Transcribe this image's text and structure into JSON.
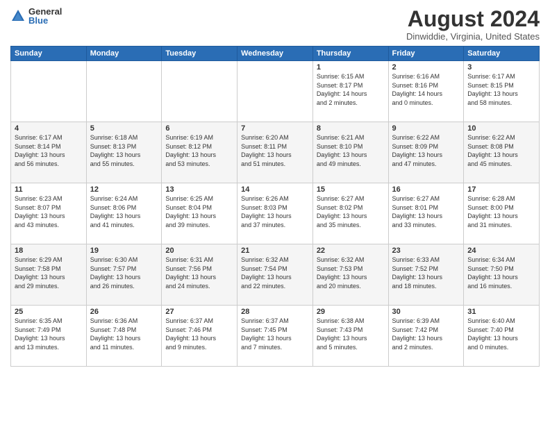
{
  "logo": {
    "general": "General",
    "blue": "Blue"
  },
  "title": "August 2024",
  "subtitle": "Dinwiddie, Virginia, United States",
  "days_header": [
    "Sunday",
    "Monday",
    "Tuesday",
    "Wednesday",
    "Thursday",
    "Friday",
    "Saturday"
  ],
  "weeks": [
    [
      {
        "day": "",
        "info": ""
      },
      {
        "day": "",
        "info": ""
      },
      {
        "day": "",
        "info": ""
      },
      {
        "day": "",
        "info": ""
      },
      {
        "day": "1",
        "info": "Sunrise: 6:15 AM\nSunset: 8:17 PM\nDaylight: 14 hours\nand 2 minutes."
      },
      {
        "day": "2",
        "info": "Sunrise: 6:16 AM\nSunset: 8:16 PM\nDaylight: 14 hours\nand 0 minutes."
      },
      {
        "day": "3",
        "info": "Sunrise: 6:17 AM\nSunset: 8:15 PM\nDaylight: 13 hours\nand 58 minutes."
      }
    ],
    [
      {
        "day": "4",
        "info": "Sunrise: 6:17 AM\nSunset: 8:14 PM\nDaylight: 13 hours\nand 56 minutes."
      },
      {
        "day": "5",
        "info": "Sunrise: 6:18 AM\nSunset: 8:13 PM\nDaylight: 13 hours\nand 55 minutes."
      },
      {
        "day": "6",
        "info": "Sunrise: 6:19 AM\nSunset: 8:12 PM\nDaylight: 13 hours\nand 53 minutes."
      },
      {
        "day": "7",
        "info": "Sunrise: 6:20 AM\nSunset: 8:11 PM\nDaylight: 13 hours\nand 51 minutes."
      },
      {
        "day": "8",
        "info": "Sunrise: 6:21 AM\nSunset: 8:10 PM\nDaylight: 13 hours\nand 49 minutes."
      },
      {
        "day": "9",
        "info": "Sunrise: 6:22 AM\nSunset: 8:09 PM\nDaylight: 13 hours\nand 47 minutes."
      },
      {
        "day": "10",
        "info": "Sunrise: 6:22 AM\nSunset: 8:08 PM\nDaylight: 13 hours\nand 45 minutes."
      }
    ],
    [
      {
        "day": "11",
        "info": "Sunrise: 6:23 AM\nSunset: 8:07 PM\nDaylight: 13 hours\nand 43 minutes."
      },
      {
        "day": "12",
        "info": "Sunrise: 6:24 AM\nSunset: 8:06 PM\nDaylight: 13 hours\nand 41 minutes."
      },
      {
        "day": "13",
        "info": "Sunrise: 6:25 AM\nSunset: 8:04 PM\nDaylight: 13 hours\nand 39 minutes."
      },
      {
        "day": "14",
        "info": "Sunrise: 6:26 AM\nSunset: 8:03 PM\nDaylight: 13 hours\nand 37 minutes."
      },
      {
        "day": "15",
        "info": "Sunrise: 6:27 AM\nSunset: 8:02 PM\nDaylight: 13 hours\nand 35 minutes."
      },
      {
        "day": "16",
        "info": "Sunrise: 6:27 AM\nSunset: 8:01 PM\nDaylight: 13 hours\nand 33 minutes."
      },
      {
        "day": "17",
        "info": "Sunrise: 6:28 AM\nSunset: 8:00 PM\nDaylight: 13 hours\nand 31 minutes."
      }
    ],
    [
      {
        "day": "18",
        "info": "Sunrise: 6:29 AM\nSunset: 7:58 PM\nDaylight: 13 hours\nand 29 minutes."
      },
      {
        "day": "19",
        "info": "Sunrise: 6:30 AM\nSunset: 7:57 PM\nDaylight: 13 hours\nand 26 minutes."
      },
      {
        "day": "20",
        "info": "Sunrise: 6:31 AM\nSunset: 7:56 PM\nDaylight: 13 hours\nand 24 minutes."
      },
      {
        "day": "21",
        "info": "Sunrise: 6:32 AM\nSunset: 7:54 PM\nDaylight: 13 hours\nand 22 minutes."
      },
      {
        "day": "22",
        "info": "Sunrise: 6:32 AM\nSunset: 7:53 PM\nDaylight: 13 hours\nand 20 minutes."
      },
      {
        "day": "23",
        "info": "Sunrise: 6:33 AM\nSunset: 7:52 PM\nDaylight: 13 hours\nand 18 minutes."
      },
      {
        "day": "24",
        "info": "Sunrise: 6:34 AM\nSunset: 7:50 PM\nDaylight: 13 hours\nand 16 minutes."
      }
    ],
    [
      {
        "day": "25",
        "info": "Sunrise: 6:35 AM\nSunset: 7:49 PM\nDaylight: 13 hours\nand 13 minutes."
      },
      {
        "day": "26",
        "info": "Sunrise: 6:36 AM\nSunset: 7:48 PM\nDaylight: 13 hours\nand 11 minutes."
      },
      {
        "day": "27",
        "info": "Sunrise: 6:37 AM\nSunset: 7:46 PM\nDaylight: 13 hours\nand 9 minutes."
      },
      {
        "day": "28",
        "info": "Sunrise: 6:37 AM\nSunset: 7:45 PM\nDaylight: 13 hours\nand 7 minutes."
      },
      {
        "day": "29",
        "info": "Sunrise: 6:38 AM\nSunset: 7:43 PM\nDaylight: 13 hours\nand 5 minutes."
      },
      {
        "day": "30",
        "info": "Sunrise: 6:39 AM\nSunset: 7:42 PM\nDaylight: 13 hours\nand 2 minutes."
      },
      {
        "day": "31",
        "info": "Sunrise: 6:40 AM\nSunset: 7:40 PM\nDaylight: 13 hours\nand 0 minutes."
      }
    ]
  ]
}
